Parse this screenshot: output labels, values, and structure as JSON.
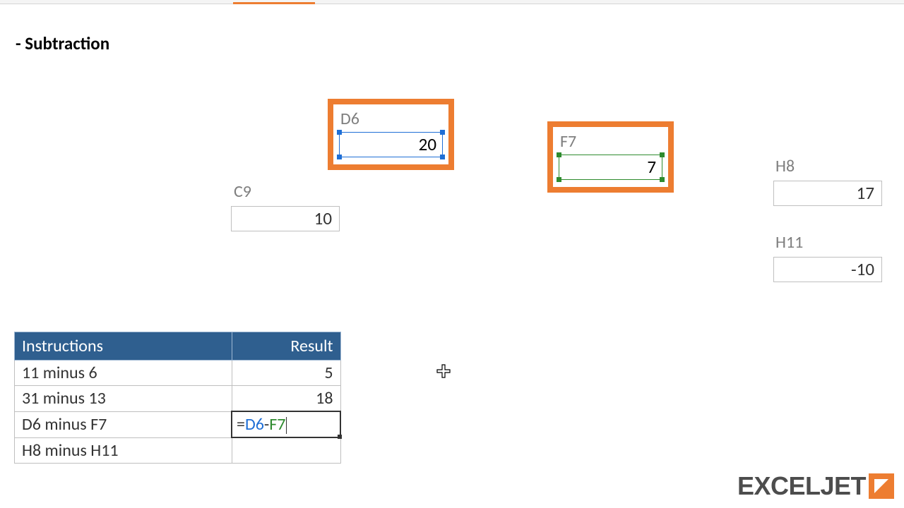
{
  "heading": "- Subtraction",
  "cells": {
    "d6": {
      "label": "D6",
      "value": "20"
    },
    "f7": {
      "label": "F7",
      "value": "7"
    },
    "c9": {
      "label": "C9",
      "value": "10"
    },
    "h8": {
      "label": "H8",
      "value": "17"
    },
    "h11": {
      "label": "H11",
      "value": "-10"
    }
  },
  "table": {
    "headers": {
      "instructions": "Instructions",
      "result": "Result"
    },
    "rows": [
      {
        "instr": "11 minus 6",
        "result": "5"
      },
      {
        "instr": "31 minus 13",
        "result": "18"
      },
      {
        "instr": "D6 minus F7",
        "result": ""
      },
      {
        "instr": "H8 minus H11",
        "result": ""
      }
    ]
  },
  "formula": {
    "eq": "=",
    "ref1": "D6",
    "op": "-",
    "ref2": "F7"
  },
  "logo": {
    "text1": "EXCEL",
    "text2": "JET"
  }
}
